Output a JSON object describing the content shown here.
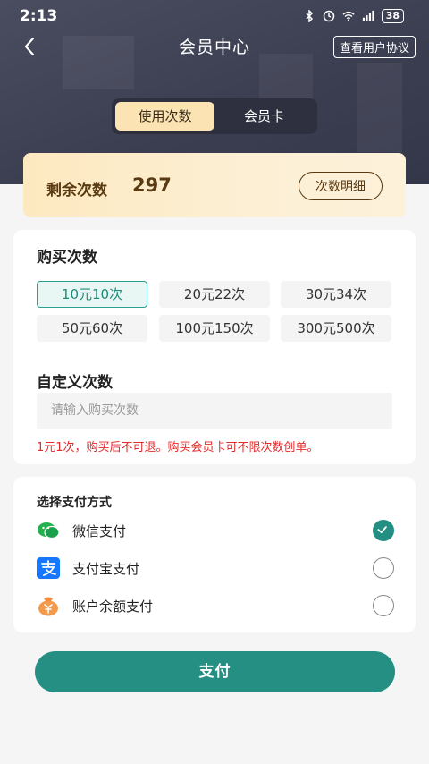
{
  "status_bar": {
    "time": "2:13",
    "battery": "38"
  },
  "nav": {
    "title": "会员中心",
    "agreement": "查看用户协议"
  },
  "tabs": [
    {
      "label": "使用次数",
      "active": true
    },
    {
      "label": "会员卡",
      "active": false
    }
  ],
  "remaining": {
    "label": "剩余次数",
    "value": "297",
    "detail_button": "次数明细"
  },
  "purchase": {
    "title": "购买次数",
    "options": [
      {
        "label": "10元10次",
        "selected": true
      },
      {
        "label": "20元22次",
        "selected": false
      },
      {
        "label": "30元34次",
        "selected": false
      },
      {
        "label": "50元60次",
        "selected": false
      },
      {
        "label": "100元150次",
        "selected": false
      },
      {
        "label": "300元500次",
        "selected": false
      }
    ],
    "custom_title": "自定义次数",
    "custom_placeholder": "请输入购买次数",
    "notice": "1元1次，购买后不可退。购买会员卡可不限次数创单。"
  },
  "payment": {
    "title": "选择支付方式",
    "methods": [
      {
        "label": "微信支付",
        "icon": "wechat-icon",
        "selected": true
      },
      {
        "label": "支付宝支付",
        "icon": "alipay-icon",
        "selected": false
      },
      {
        "label": "账户余额支付",
        "icon": "wallet-icon",
        "selected": false
      }
    ]
  },
  "pay_button": "支付",
  "colors": {
    "accent": "#248f82",
    "header_bg": "#3f4154",
    "gold": "#fbe3b4",
    "warning": "#e32b2b"
  }
}
